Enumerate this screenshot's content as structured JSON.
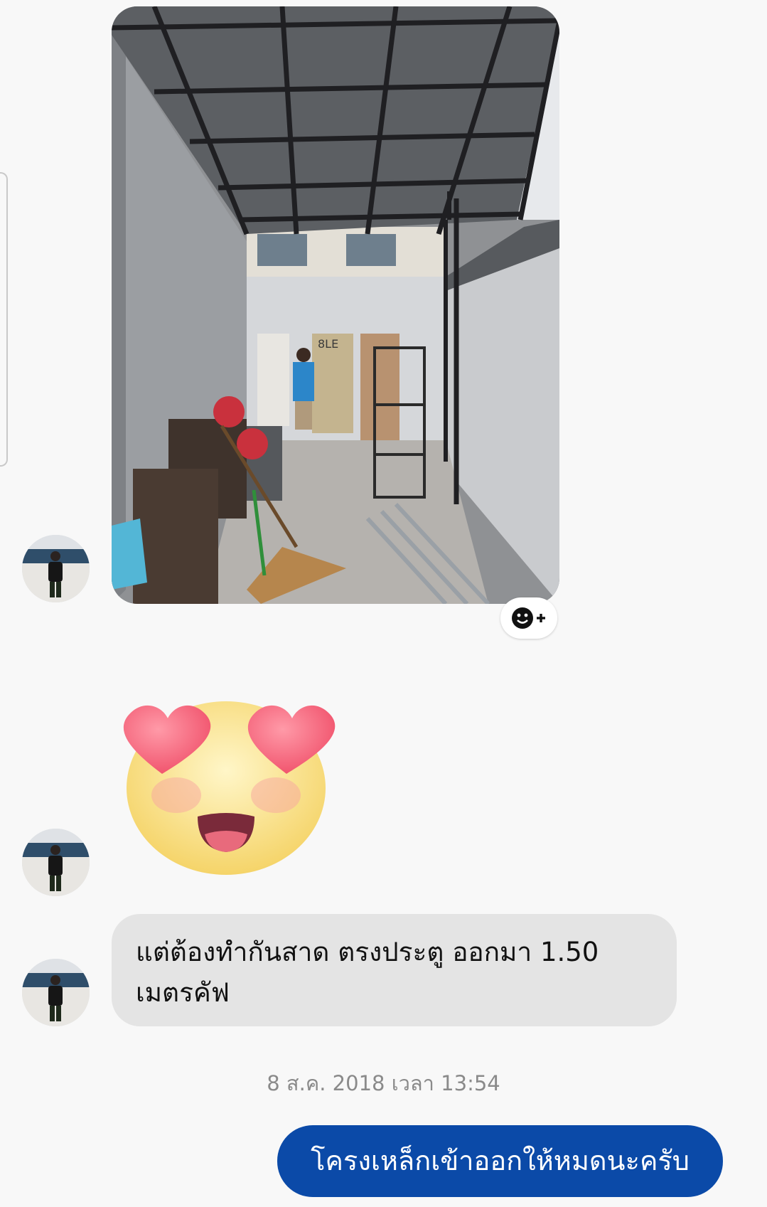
{
  "conversation": {
    "incoming_message": "แต่ต้องทำกันสาด ตรงประตู ออกมา 1.50\nเมตรคัฟ",
    "timestamp": "8 ส.ค. 2018 เวลา 13:54",
    "outgoing_message": "โครงเหล็กเข้าออกให้หมดนะครับ"
  },
  "photo": {
    "sign_text": "8LE"
  },
  "icons": {
    "reaction": "add-reaction-icon",
    "sticker": "heart-eyes-sticker",
    "avatar": "contact-avatar"
  },
  "colors": {
    "incoming_bubble": "#e4e4e4",
    "outgoing_bubble": "#0b4aa8",
    "background": "#f8f8f8"
  }
}
